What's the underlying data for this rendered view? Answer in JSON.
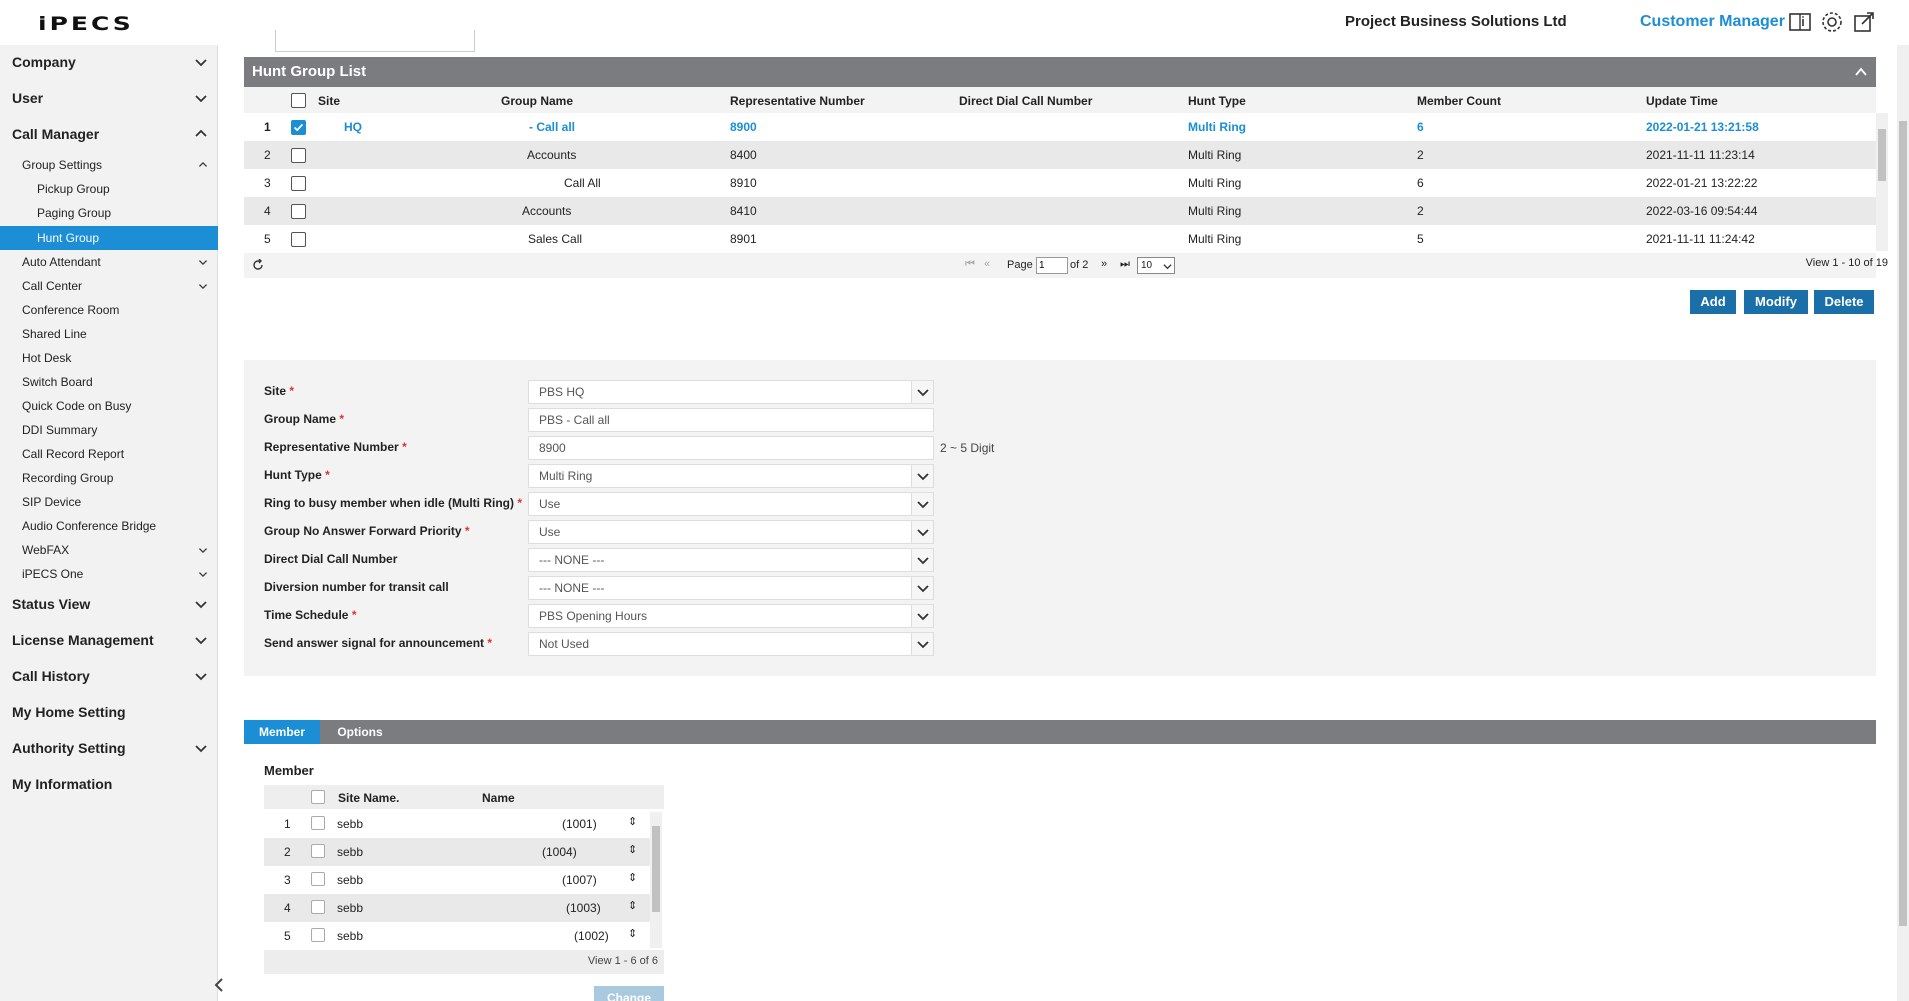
{
  "header": {
    "logo": "iPECS",
    "company": "Project Business Solutions Ltd",
    "role": "Customer Manager",
    "icons": [
      "manual-book-icon",
      "gear-icon",
      "export-icon"
    ]
  },
  "sidebar": {
    "items": [
      {
        "label": "Company",
        "level": 0,
        "expanded": false
      },
      {
        "label": "User",
        "level": 0,
        "expanded": false
      },
      {
        "label": "Call Manager",
        "level": 0,
        "expanded": true
      },
      {
        "label": "Group Settings",
        "level": 1,
        "expanded": true
      },
      {
        "label": "Pickup Group",
        "level": 2
      },
      {
        "label": "Paging Group",
        "level": 2
      },
      {
        "label": "Hunt Group",
        "level": 2,
        "active": true
      },
      {
        "label": "Auto Attendant",
        "level": 1,
        "expanded": false
      },
      {
        "label": "Call Center",
        "level": 1,
        "expanded": false
      },
      {
        "label": "Conference Room",
        "level": 1
      },
      {
        "label": "Shared Line",
        "level": 1
      },
      {
        "label": "Hot Desk",
        "level": 1
      },
      {
        "label": "Switch Board",
        "level": 1
      },
      {
        "label": "Quick Code on Busy",
        "level": 1
      },
      {
        "label": "DDI Summary",
        "level": 1
      },
      {
        "label": "Call Record Report",
        "level": 1
      },
      {
        "label": "Recording Group",
        "level": 1
      },
      {
        "label": "SIP Device",
        "level": 1
      },
      {
        "label": "Audio Conference Bridge",
        "level": 1
      },
      {
        "label": "WebFAX",
        "level": 1,
        "expanded": false
      },
      {
        "label": "iPECS One",
        "level": 1,
        "expanded": false
      },
      {
        "label": "Status View",
        "level": 0,
        "expanded": false
      },
      {
        "label": "License Management",
        "level": 0,
        "expanded": false
      },
      {
        "label": "Call History",
        "level": 0,
        "expanded": false
      },
      {
        "label": "My Home Setting",
        "level": 0
      },
      {
        "label": "Authority Setting",
        "level": 0,
        "expanded": false
      },
      {
        "label": "My Information",
        "level": 0
      }
    ]
  },
  "hunt_group_list": {
    "title": "Hunt Group List",
    "columns": [
      "Site",
      "Group Name",
      "Representative Number",
      "Direct Dial Call Number",
      "Hunt Type",
      "Member Count",
      "Update Time"
    ],
    "rows": [
      {
        "no": "1",
        "site": "HQ",
        "group_name": "- Call all",
        "rep": "8900",
        "ddi": "",
        "hunt_type": "Multi Ring",
        "members": "6",
        "updated": "2022-01-21 13:21:58",
        "checked": true
      },
      {
        "no": "2",
        "site": "",
        "group_name": "Accounts",
        "rep": "8400",
        "ddi": "",
        "hunt_type": "Multi Ring",
        "members": "2",
        "updated": "2021-11-11 11:23:14",
        "checked": false
      },
      {
        "no": "3",
        "site": "",
        "group_name": "Call All",
        "rep": "8910",
        "ddi": "",
        "hunt_type": "Multi Ring",
        "members": "6",
        "updated": "2022-01-21 13:22:22",
        "checked": false
      },
      {
        "no": "4",
        "site": "",
        "group_name": "Accounts",
        "rep": "8410",
        "ddi": "",
        "hunt_type": "Multi Ring",
        "members": "2",
        "updated": "2022-03-16 09:54:44",
        "checked": false
      },
      {
        "no": "5",
        "site": "",
        "group_name": "Sales Call",
        "rep": "8901",
        "ddi": "",
        "hunt_type": "Multi Ring",
        "members": "5",
        "updated": "2021-11-11 11:24:42",
        "checked": false
      }
    ],
    "pager": {
      "page_label": "Page",
      "page_value": "1",
      "of_label": "of 2",
      "page_size": "10",
      "view_info": "View 1 - 10 of 19"
    },
    "buttons": {
      "add": "Add",
      "modify": "Modify",
      "delete": "Delete"
    }
  },
  "form": {
    "fields": [
      {
        "label": "Site",
        "required": true,
        "value": "PBS HQ",
        "type": "select"
      },
      {
        "label": "Group Name",
        "required": true,
        "value": "PBS - Call all",
        "type": "text"
      },
      {
        "label": "Representative Number",
        "required": true,
        "value": "8900",
        "type": "text",
        "hint": "2 ~ 5 Digit"
      },
      {
        "label": "Hunt Type",
        "required": true,
        "value": "Multi Ring",
        "type": "select"
      },
      {
        "label": "Ring to busy member when idle (Multi Ring)",
        "required": true,
        "value": "Use",
        "type": "select"
      },
      {
        "label": "Group No Answer Forward Priority",
        "required": true,
        "value": "Use",
        "type": "select"
      },
      {
        "label": "Direct Dial Call Number",
        "required": false,
        "value": "--- NONE ---",
        "type": "select"
      },
      {
        "label": "Diversion number for transit call",
        "required": false,
        "value": "--- NONE ---",
        "type": "select"
      },
      {
        "label": "Time Schedule",
        "required": true,
        "value": "PBS Opening Hours",
        "type": "select"
      },
      {
        "label": "Send answer signal for announcement",
        "required": true,
        "value": "Not Used",
        "type": "select"
      }
    ]
  },
  "tabs": [
    {
      "label": "Member",
      "active": true
    },
    {
      "label": "Options",
      "active": false
    }
  ],
  "members": {
    "title": "Member",
    "columns": [
      "Site Name.",
      "Name"
    ],
    "rows": [
      {
        "no": "1",
        "site": "sebb",
        "name": "(1001)"
      },
      {
        "no": "2",
        "site": "sebb",
        "name": "(1004)"
      },
      {
        "no": "3",
        "site": "sebb",
        "name": "(1007)"
      },
      {
        "no": "4",
        "site": "sebb",
        "name": "(1003)"
      },
      {
        "no": "5",
        "site": "sebb",
        "name": "(1002)"
      }
    ],
    "view_info": "View 1 - 6 of 6",
    "change_button": "Change"
  },
  "colors": {
    "accent": "#1b8ed6",
    "panel_header": "#7b7c80",
    "button": "#1a6fa8"
  }
}
